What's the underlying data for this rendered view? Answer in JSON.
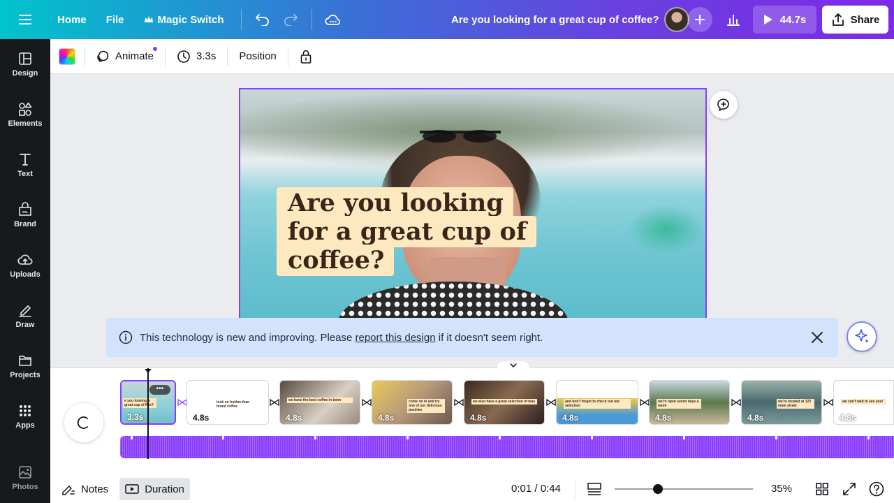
{
  "topbar": {
    "home": "Home",
    "file": "File",
    "magic_switch": "Magic Switch",
    "title": "Are you looking for a great cup of coffee?",
    "play_duration": "44.7s",
    "share": "Share"
  },
  "rail": {
    "items": [
      {
        "label": "Design",
        "icon": "design-icon"
      },
      {
        "label": "Elements",
        "icon": "elements-icon"
      },
      {
        "label": "Text",
        "icon": "text-icon"
      },
      {
        "label": "Brand",
        "icon": "brand-icon"
      },
      {
        "label": "Uploads",
        "icon": "uploads-icon"
      },
      {
        "label": "Draw",
        "icon": "draw-icon"
      },
      {
        "label": "Projects",
        "icon": "projects-icon"
      },
      {
        "label": "Apps",
        "icon": "apps-icon"
      },
      {
        "label": "Photos",
        "icon": "photos-icon"
      }
    ]
  },
  "toolbar": {
    "animate": "Animate",
    "duration": "3.3s",
    "position": "Position"
  },
  "canvas": {
    "headline_lines": [
      "Are you looking",
      "for a great cup of",
      "coffee?"
    ]
  },
  "banner": {
    "text_before": "This technology is new and improving. Please ",
    "link": "report this design",
    "text_after": " if it doesn't seem right."
  },
  "timeline": {
    "clips": [
      {
        "duration": "3.3s",
        "caption": "e you looking a great cup of ffee?"
      },
      {
        "duration": "4.8s",
        "caption": "look no further than brand coffee"
      },
      {
        "duration": "4.8s",
        "caption": "we have the best coffee in town"
      },
      {
        "duration": "4.8s",
        "caption": "come on in and try one of our delicious pastries"
      },
      {
        "duration": "4.8s",
        "caption": "we also have a great selection of teas"
      },
      {
        "duration": "4.8s",
        "caption": "and don't forget to check out our selection"
      },
      {
        "duration": "4.8s",
        "caption": "we're open seven days a week"
      },
      {
        "duration": "4.8s",
        "caption": "we're located at 123 main street"
      },
      {
        "duration": "4.8s",
        "caption": "we can't wait to see you!"
      }
    ]
  },
  "bottombar": {
    "notes": "Notes",
    "duration": "Duration",
    "time": "0:01 / 0:44",
    "zoom": "35%",
    "zoom_level": 0.35
  },
  "colors": {
    "accent": "#8b3dff",
    "banner_bg": "#d3e3fd",
    "caption_bg": "#fde8c0"
  }
}
